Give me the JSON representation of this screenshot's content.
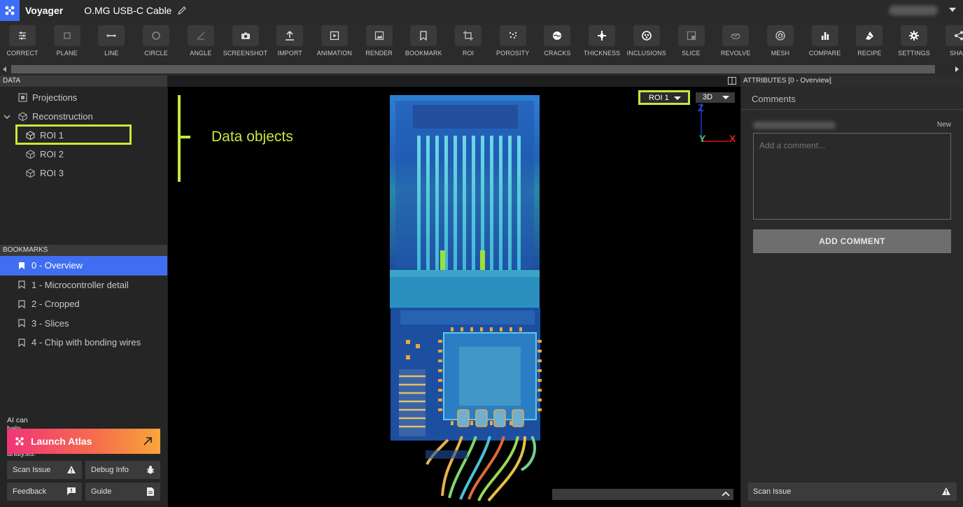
{
  "app": {
    "name": "Voyager",
    "document_title": "O.MG USB-C Cable"
  },
  "toolbar": {
    "tools": [
      {
        "label": "CORRECT",
        "icon": "sliders-icon"
      },
      {
        "label": "PLANE",
        "icon": "square-icon"
      },
      {
        "label": "LINE",
        "icon": "line-icon"
      },
      {
        "label": "CIRCLE",
        "icon": "circle-icon"
      },
      {
        "label": "ANGLE",
        "icon": "angle-icon"
      },
      {
        "label": "SCREENSHOT",
        "icon": "camera-icon"
      },
      {
        "label": "IMPORT",
        "icon": "upload-icon"
      },
      {
        "label": "ANIMATION",
        "icon": "play-icon"
      },
      {
        "label": "RENDER",
        "icon": "image-icon"
      },
      {
        "label": "BOOKMARK",
        "icon": "bookmark-icon"
      },
      {
        "label": "ROI",
        "icon": "crop-icon"
      },
      {
        "label": "POROSITY",
        "icon": "dots-icon"
      },
      {
        "label": "CRACKS",
        "icon": "crack-icon"
      },
      {
        "label": "THICKNESS",
        "icon": "thickness-icon"
      },
      {
        "label": "INCLUSIONS",
        "icon": "inclusions-icon"
      },
      {
        "label": "SLICE",
        "icon": "slice-icon"
      },
      {
        "label": "REVOLVE",
        "icon": "revolve-icon"
      },
      {
        "label": "MESH",
        "icon": "mesh-icon"
      },
      {
        "label": "COMPARE",
        "icon": "bar-chart-icon"
      },
      {
        "label": "RECIPE",
        "icon": "recipe-icon"
      },
      {
        "label": "SETTINGS",
        "icon": "gear-icon"
      },
      {
        "label": "SHAR",
        "icon": "share-icon"
      }
    ]
  },
  "data_panel": {
    "header": "DATA",
    "items": [
      {
        "label": "Projections",
        "level": 0
      },
      {
        "label": "Reconstruction",
        "level": 0,
        "expanded": true
      },
      {
        "label": "ROI 1",
        "level": 1,
        "highlighted": true
      },
      {
        "label": "ROI 2",
        "level": 1
      },
      {
        "label": "ROI 3",
        "level": 1
      }
    ]
  },
  "bookmarks_panel": {
    "header": "BOOKMARKS",
    "items": [
      {
        "label": "0 - Overview",
        "active": true
      },
      {
        "label": "1 - Microcontroller detail"
      },
      {
        "label": "2 - Cropped"
      },
      {
        "label": "3 - Slices"
      },
      {
        "label": "4 - Chip with bonding wires"
      }
    ]
  },
  "assistant": {
    "prompt": "AI can help with your analysis.",
    "launch_label": "Launch Atlas"
  },
  "footer_buttons": {
    "scan_issue": "Scan Issue",
    "debug_info": "Debug Info",
    "feedback": "Feedback",
    "guide": "Guide"
  },
  "viewport": {
    "annotation": "Data objects",
    "roi_selector": "ROI 1",
    "view_mode": "3D",
    "axes": {
      "z": "Z",
      "y": "Y",
      "x": "X"
    }
  },
  "attributes_panel": {
    "header": "ATTRIBUTES [0 - Overview]",
    "comments_title": "Comments",
    "new_label": "New",
    "comment_placeholder": "Add a comment...",
    "add_comment_label": "ADD COMMENT",
    "scan_issue": "Scan Issue"
  },
  "colors": {
    "accent": "#3f6ef0",
    "highlight": "#c6e83d",
    "atlas_gradient": [
      "#f2337a",
      "#f9a53a"
    ]
  }
}
